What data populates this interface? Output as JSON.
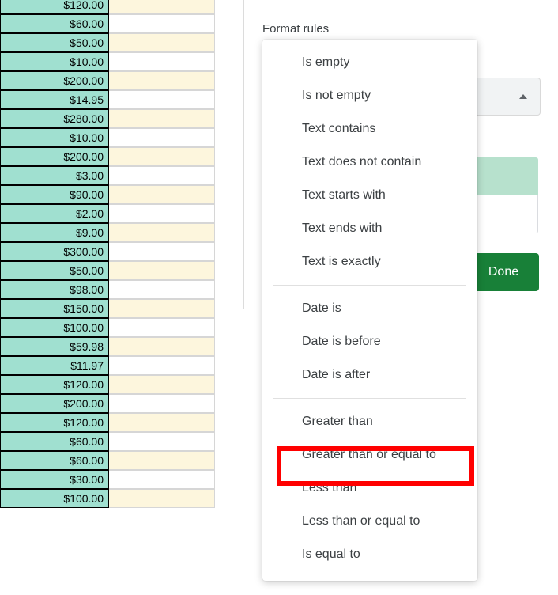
{
  "grid": {
    "rows": [
      "$120.00",
      "$60.00",
      "$50.00",
      "$10.00",
      "$200.00",
      "$14.95",
      "$280.00",
      "$10.00",
      "$200.00",
      "$3.00",
      "$90.00",
      "$2.00",
      "$9.00",
      "$300.00",
      "$50.00",
      "$98.00",
      "$150.00",
      "$100.00",
      "$59.98",
      "$11.97",
      "$120.00",
      "$200.00",
      "$120.00",
      "$60.00",
      "$60.00",
      "$30.00",
      "$100.00"
    ]
  },
  "panel": {
    "title": "Format rules",
    "done_label": "Done"
  },
  "menu": {
    "group1": [
      "Is empty",
      "Is not empty",
      "Text contains",
      "Text does not contain",
      "Text starts with",
      "Text ends with",
      "Text is exactly"
    ],
    "group2": [
      "Date is",
      "Date is before",
      "Date is after"
    ],
    "group3": [
      "Greater than",
      "Greater than or equal to",
      "Less than",
      "Less than or equal to",
      "Is equal to"
    ]
  },
  "highlighted_option": "Greater than or equal to"
}
